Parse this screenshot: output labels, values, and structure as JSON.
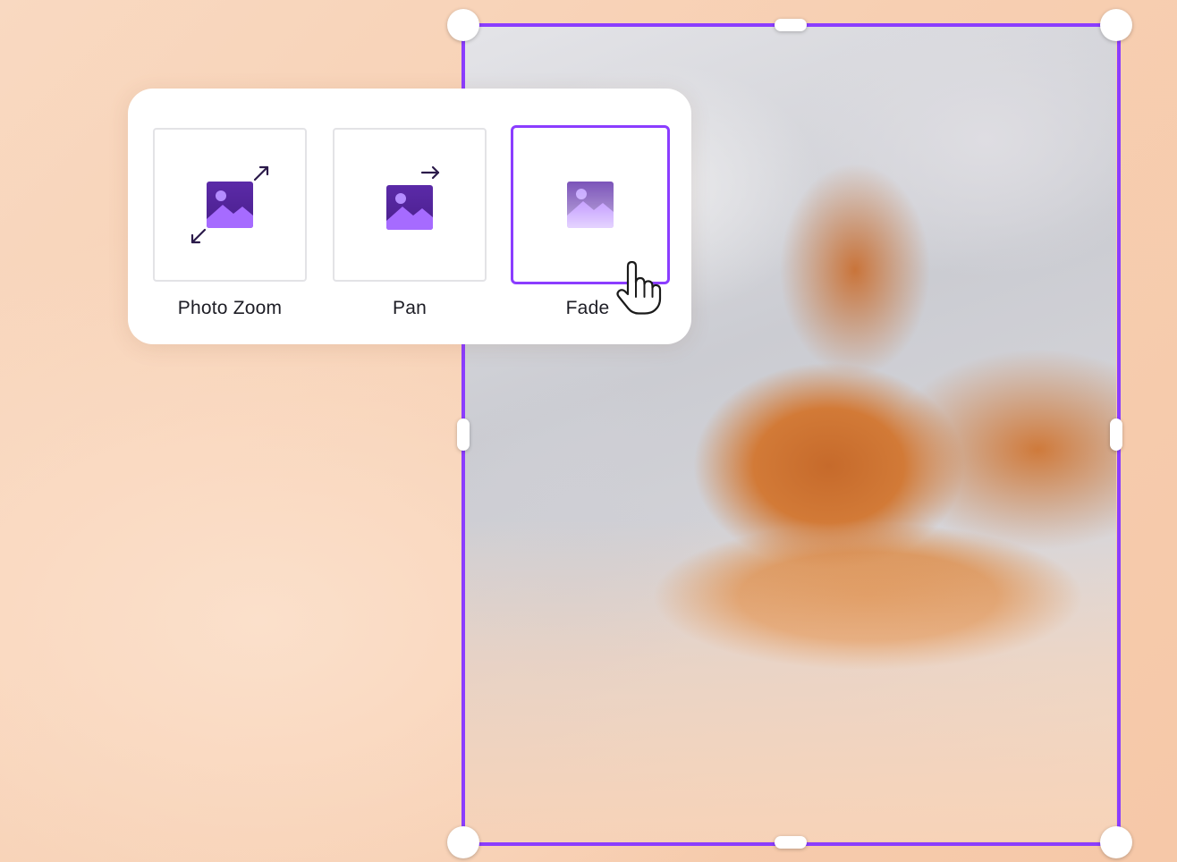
{
  "canvas": {
    "photo_description_icon": "photo-canvas",
    "selection_color": "#8b3dff"
  },
  "animation_panel": {
    "options": [
      {
        "label": "Photo Zoom",
        "icon": "photo-zoom-icon",
        "selected": false
      },
      {
        "label": "Pan",
        "icon": "pan-icon",
        "selected": false
      },
      {
        "label": "Fade",
        "icon": "fade-icon",
        "selected": true
      }
    ]
  },
  "colors": {
    "accent": "#8b3dff",
    "icon_dark": "#4a1f8c",
    "icon_light": "#a66bff",
    "background": "#f8d2b6"
  },
  "cursor": {
    "icon": "hand-pointer-icon"
  }
}
